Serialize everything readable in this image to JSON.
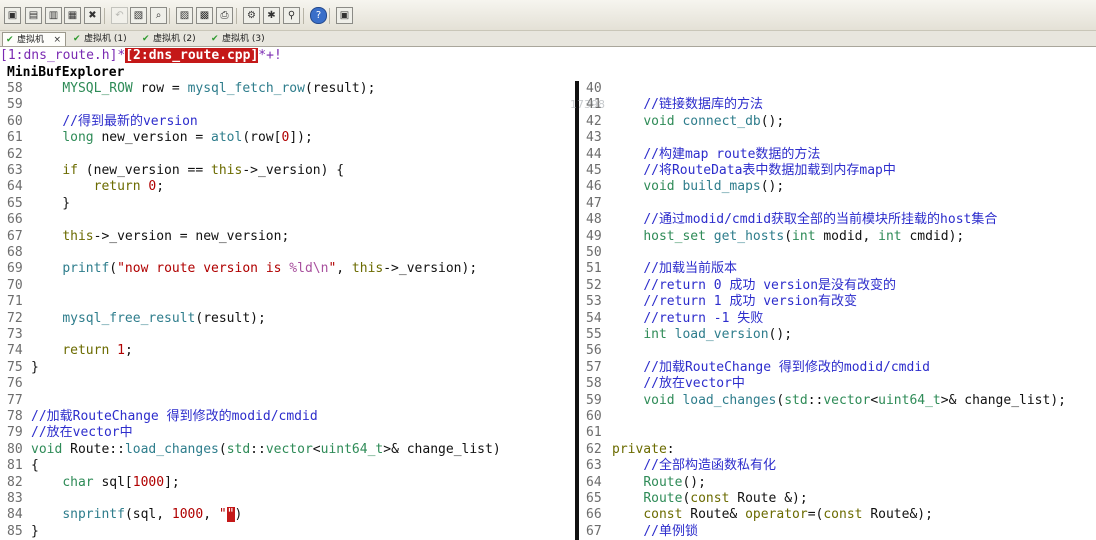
{
  "toolbar": {
    "buttons": [
      {
        "name": "open-file-icon",
        "glyph": "▣"
      },
      {
        "name": "save-icon",
        "glyph": "▤"
      },
      {
        "name": "save-all-icon",
        "glyph": "▥"
      },
      {
        "name": "session-icon",
        "glyph": "▦"
      },
      {
        "name": "close-buffer-icon",
        "glyph": "✖"
      },
      {
        "name": "undo-icon",
        "glyph": "↶",
        "disabled": true
      },
      {
        "name": "paste-icon",
        "glyph": "▧"
      },
      {
        "name": "find-icon",
        "glyph": "⌕"
      },
      {
        "name": "load-session-icon",
        "glyph": "▨"
      },
      {
        "name": "save-session-icon",
        "glyph": "▩"
      },
      {
        "name": "print-icon",
        "glyph": "⎙"
      },
      {
        "name": "make-icon",
        "glyph": "⚙"
      },
      {
        "name": "settings-icon",
        "glyph": "✱"
      },
      {
        "name": "pin-icon",
        "glyph": "⚲"
      },
      {
        "name": "help-icon",
        "glyph": "?"
      },
      {
        "name": "window-icon",
        "glyph": "▣"
      }
    ]
  },
  "tabs": [
    {
      "label": "虚拟机",
      "active": true,
      "closable": true
    },
    {
      "label": "虚拟机 (1)",
      "active": false
    },
    {
      "label": "虚拟机 (2)",
      "active": false
    },
    {
      "label": "虚拟机 (3)",
      "active": false
    }
  ],
  "buffers": {
    "buf1": "[1:dns_route.h]",
    "sep": "*",
    "buf2": "[2:dns_route.cpp]",
    "mod": "*+!"
  },
  "mbe_title": "MiniBufExplorer",
  "watermark": "17398",
  "left_lines": [
    {
      "n": "58",
      "t": "    MYSQL_ROW row = mysql_fetch_row(result);"
    },
    {
      "n": "59",
      "t": ""
    },
    {
      "n": "60",
      "t": "    //得到最新的version"
    },
    {
      "n": "61",
      "t": "    long new_version = atol(row[0]);"
    },
    {
      "n": "62",
      "t": ""
    },
    {
      "n": "63",
      "t": "    if (new_version == this->_version) {"
    },
    {
      "n": "64",
      "t": "        return 0;"
    },
    {
      "n": "65",
      "t": "    }"
    },
    {
      "n": "66",
      "t": ""
    },
    {
      "n": "67",
      "t": "    this->_version = new_version;"
    },
    {
      "n": "68",
      "t": ""
    },
    {
      "n": "69",
      "t": "    printf(\"now route version is %ld\\n\", this->_version);"
    },
    {
      "n": "70",
      "t": ""
    },
    {
      "n": "71",
      "t": ""
    },
    {
      "n": "72",
      "t": "    mysql_free_result(result);"
    },
    {
      "n": "73",
      "t": ""
    },
    {
      "n": "74",
      "t": "    return 1;"
    },
    {
      "n": "75",
      "t": "}"
    },
    {
      "n": "76",
      "t": ""
    },
    {
      "n": "77",
      "t": ""
    },
    {
      "n": "78",
      "t": "//加载RouteChange 得到修改的modid/cmdid"
    },
    {
      "n": "79",
      "t": "//放在vector中"
    },
    {
      "n": "80",
      "t": "void Route::load_changes(std::vector<uint64_t>& change_list)"
    },
    {
      "n": "81",
      "t": "{"
    },
    {
      "n": "82",
      "t": "    char sql[1000];"
    },
    {
      "n": "83",
      "t": ""
    },
    {
      "n": "84",
      "t": "    snprintf(sql, 1000, \"\")"
    },
    {
      "n": "85",
      "t": "}"
    }
  ],
  "right_lines": [
    {
      "n": "40",
      "t": ""
    },
    {
      "n": "41",
      "t": "    //链接数据库的方法"
    },
    {
      "n": "42",
      "t": "    void connect_db();"
    },
    {
      "n": "43",
      "t": ""
    },
    {
      "n": "44",
      "t": "    //构建map route数据的方法"
    },
    {
      "n": "45",
      "t": "    //将RouteData表中数据加载到内存map中"
    },
    {
      "n": "46",
      "t": "    void build_maps();"
    },
    {
      "n": "47",
      "t": ""
    },
    {
      "n": "48",
      "t": "    //通过modid/cmdid获取全部的当前模块所挂载的host集合"
    },
    {
      "n": "49",
      "t": "    host_set get_hosts(int modid, int cmdid);"
    },
    {
      "n": "50",
      "t": ""
    },
    {
      "n": "51",
      "t": "    //加载当前版本"
    },
    {
      "n": "52",
      "t": "    //return 0 成功 version是没有改变的"
    },
    {
      "n": "53",
      "t": "    //return 1 成功 version有改变"
    },
    {
      "n": "54",
      "t": "    //return -1 失败"
    },
    {
      "n": "55",
      "t": "    int load_version();"
    },
    {
      "n": "56",
      "t": ""
    },
    {
      "n": "57",
      "t": "    //加载RouteChange 得到修改的modid/cmdid"
    },
    {
      "n": "58",
      "t": "    //放在vector中"
    },
    {
      "n": "59",
      "t": "    void load_changes(std::vector<uint64_t>& change_list);"
    },
    {
      "n": "60",
      "t": ""
    },
    {
      "n": "61",
      "t": ""
    },
    {
      "n": "62",
      "t": "private:"
    },
    {
      "n": "63",
      "t": "    //全部构造函数私有化"
    },
    {
      "n": "64",
      "t": "    Route();"
    },
    {
      "n": "65",
      "t": "    Route(const Route &);"
    },
    {
      "n": "66",
      "t": "    const Route& operator=(const Route&);"
    },
    {
      "n": "67",
      "t": "    //单例锁"
    }
  ],
  "colors": {
    "keyword": "#6b6b00",
    "type": "#2e8b57",
    "function": "#2e7d8c",
    "comment": "#2d2dcc",
    "number": "#b00000",
    "active_buffer_bg": "#c41818",
    "split_bar": "#111111"
  }
}
